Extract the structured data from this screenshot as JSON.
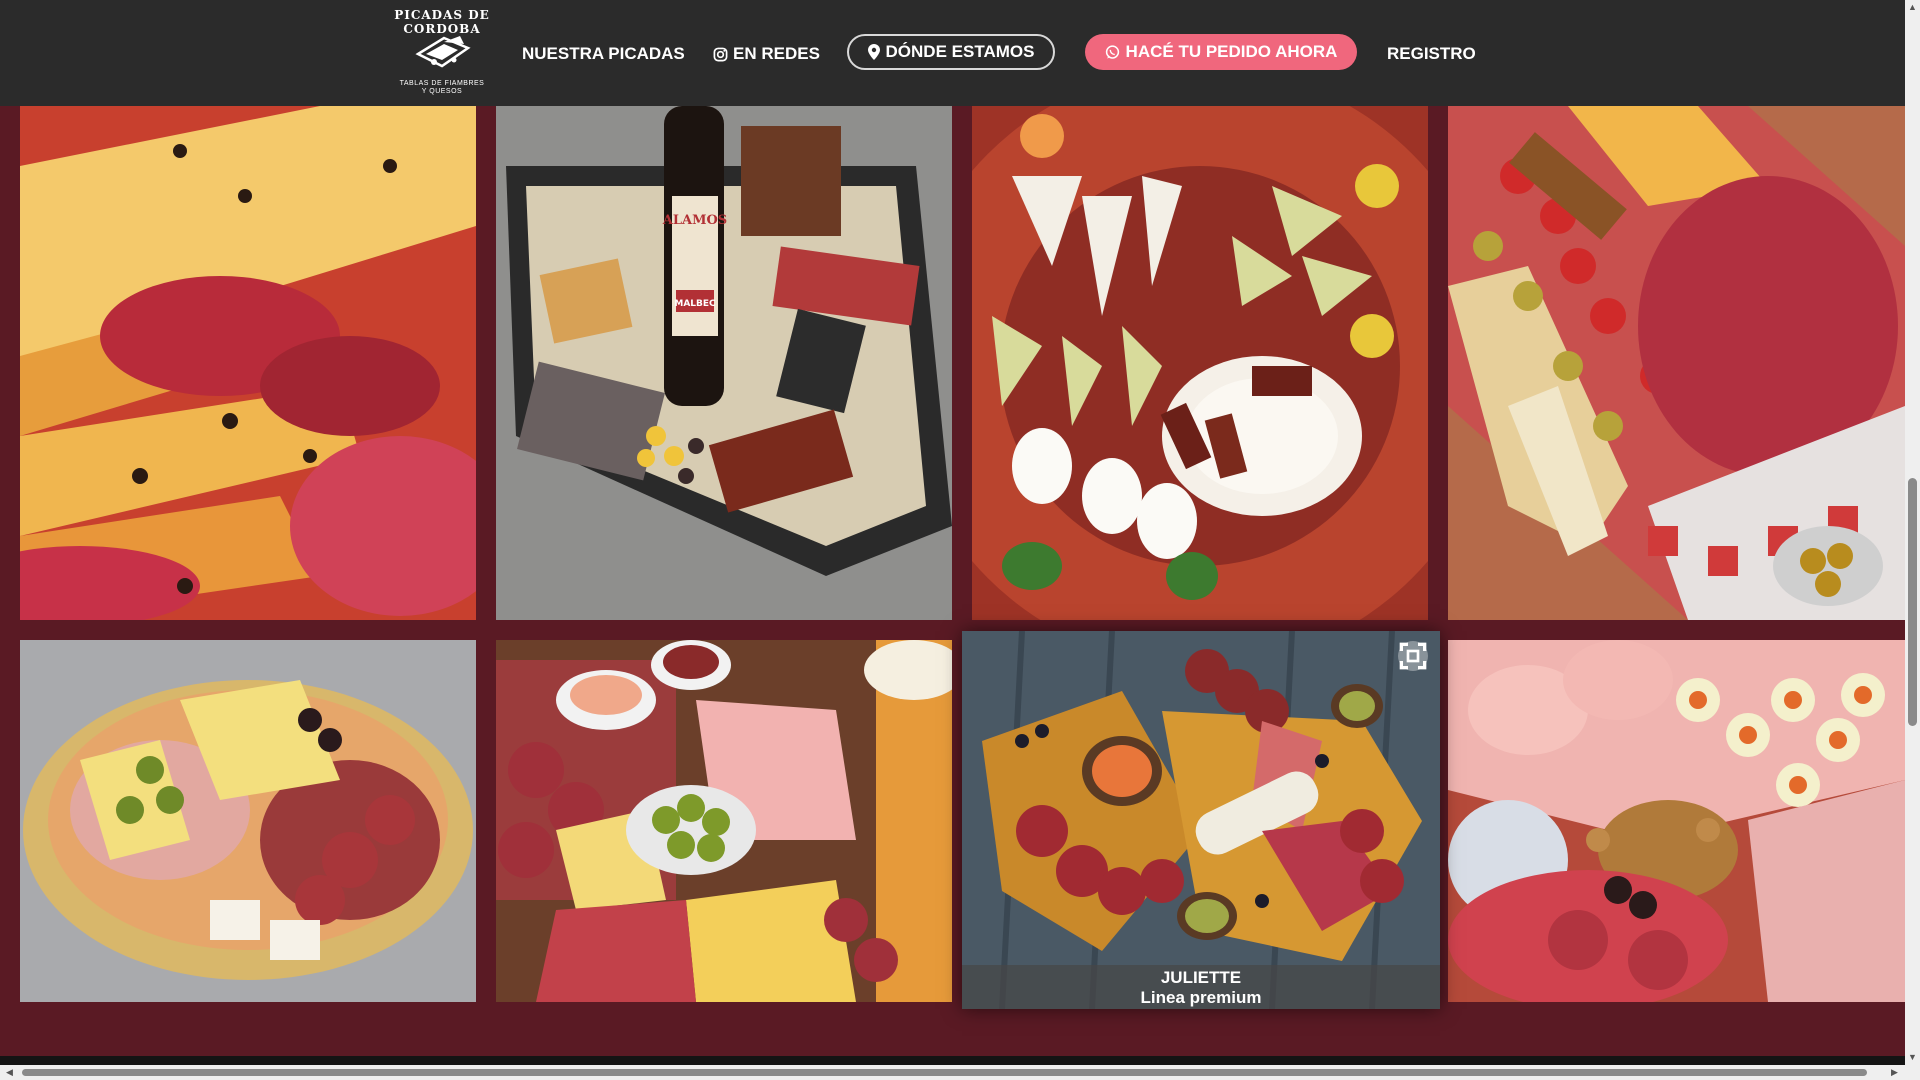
{
  "brand": {
    "arc_text": "PICADAS DE CORDOBA",
    "subtitle_line1": "TABLAS DE FIAMBRES",
    "subtitle_line2": "Y QUESOS"
  },
  "nav": {
    "picadas": "NUESTRA PICADAS",
    "redes": "EN REDES",
    "donde": "DÓNDE ESTAMOS",
    "pedido": "HACÉ TU PEDIDO AHORA",
    "registro": "REGISTRO"
  },
  "colors": {
    "header_bg": "#2b2b2b",
    "page_bg": "#5a1a24",
    "accent_pink": "#f0677d"
  },
  "icons": {
    "redes": "instagram-icon",
    "donde": "map-pin-icon",
    "pedido": "whatsapp-icon",
    "expand": "expand-icon"
  },
  "gallery": {
    "featured": {
      "name": "JULIETTE",
      "line": "Linea premium"
    },
    "bottle_label": "ALAMOS",
    "bottle_variety": "MALBEC"
  }
}
